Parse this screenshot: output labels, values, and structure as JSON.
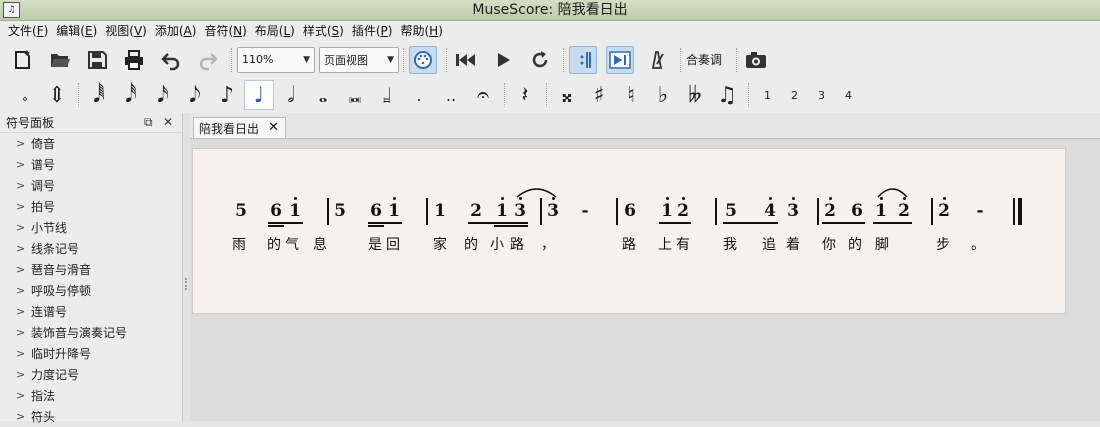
{
  "window": {
    "title": "MuseScore: 陪我看日出",
    "icon_label": "♫"
  },
  "menu": [
    {
      "label": "文件(",
      "key": "F",
      "tail": ")"
    },
    {
      "label": "编辑(",
      "key": "E",
      "tail": ")"
    },
    {
      "label": "视图(",
      "key": "V",
      "tail": ")"
    },
    {
      "label": "添加(",
      "key": "A",
      "tail": ")"
    },
    {
      "label": "音符(",
      "key": "N",
      "tail": ")"
    },
    {
      "label": "布局(",
      "key": "L",
      "tail": ")"
    },
    {
      "label": "样式(",
      "key": "S",
      "tail": ")"
    },
    {
      "label": "插件(",
      "key": "P",
      "tail": ")"
    },
    {
      "label": "帮助(",
      "key": "H",
      "tail": ")"
    }
  ],
  "toolbar": {
    "zoom_value": "110%",
    "view_mode": "页面视图",
    "concert_pitch_label": "合奏调",
    "icons": [
      "new-score-icon",
      "open-icon",
      "save-icon",
      "print-icon",
      "undo-icon",
      "redo-icon",
      "midi-input-icon",
      "rewind-icon",
      "play-icon",
      "loop-icon",
      "repeat-playback-icon",
      "pan-icon",
      "metronome-icon",
      "camera-icon"
    ]
  },
  "note_input": {
    "tools": [
      "𝆹",
      "⇕",
      "𝅘𝅥𝅱",
      "𝅘𝅥𝅰",
      "𝅘𝅥𝅯",
      "𝅘𝅥𝅮",
      "♪",
      "♩",
      "𝅗𝅥",
      "𝅝",
      "𝅜",
      "𝆷",
      ".",
      "..",
      "𝄐",
      "𝄽",
      "𝄪",
      "♯",
      "♮",
      "♭",
      "𝄫",
      "♫"
    ],
    "voices": [
      "1",
      "2",
      "3",
      "4"
    ],
    "active_index": 7
  },
  "palette": {
    "title": "符号面板",
    "items": [
      "倚音",
      "谱号",
      "调号",
      "拍号",
      "小节线",
      "线条记号",
      "琶音与滑音",
      "呼吸与停顿",
      "连谱号",
      "装饰音与演奏记号",
      "临时升降号",
      "力度记号",
      "指法",
      "符头"
    ]
  },
  "score": {
    "tab_title": "陪我看日出",
    "notes": [
      "5",
      "6",
      "1",
      "5",
      "6",
      "1",
      "1",
      "2",
      "1",
      "3",
      "3",
      "-",
      "6",
      "1",
      "2",
      "5",
      "4",
      "3",
      "2",
      "6",
      "1",
      "2",
      "2",
      "-"
    ],
    "lyrics": [
      "雨",
      "的",
      "气",
      "息",
      "是",
      "回",
      "家",
      "的",
      "小",
      "路",
      "，",
      "路",
      "上",
      "有",
      "我",
      "追",
      "着",
      "你",
      "的",
      "脚",
      "步",
      "。"
    ]
  }
}
